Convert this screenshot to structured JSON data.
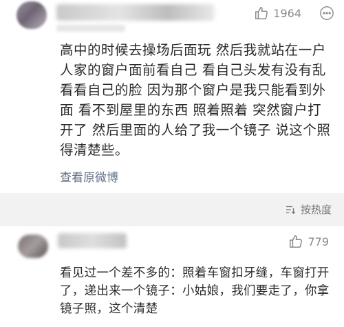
{
  "comment1": {
    "likes": "1964",
    "text": "高中的时候去操场后面玩 然后我就站在一户人家的窗户面前看自己 看自己头发有没有乱 看看自己的脸 因为那个窗户是我只能看到外面 看不到屋里的东西 照着照着 突然窗户打开了 然后里面的人给了我一个镜子 说这个照得清楚些。",
    "view_link": "查看原微博"
  },
  "sort": {
    "label": "按热度"
  },
  "comment2": {
    "likes": "779",
    "text": "看见过一个差不多的：照着车窗扣牙缝，车窗打开了，递出来一个镜子：小姑娘，我们要走了，你拿镜子照，这个清楚"
  },
  "colors": {
    "link": "#5f6f84",
    "separator": "#f2f2f2",
    "meta": "#888888"
  }
}
